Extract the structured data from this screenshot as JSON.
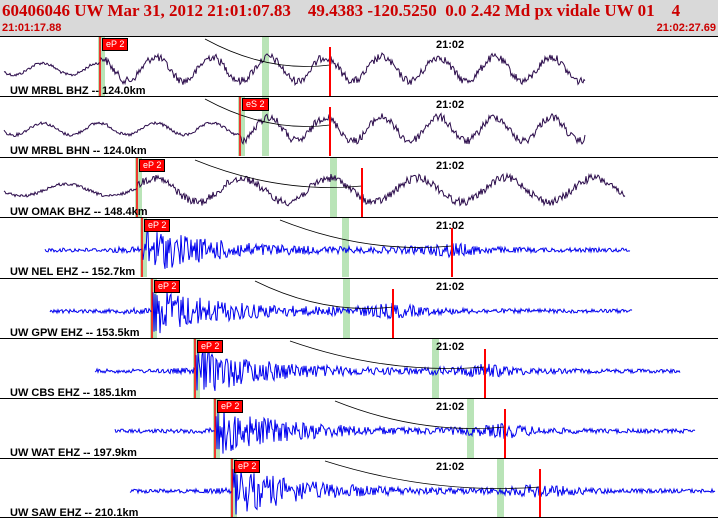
{
  "header": {
    "title": "60406046 UW Mar 31, 2012 21:01:07.83    49.4383 -120.5250  0.0 2.42 Md px vidale UW 01    4",
    "time_start": "21:01:17.88",
    "time_end": "21:02:27.69"
  },
  "colors": {
    "header_bg": "#d9d9d9",
    "header_text": "#cc0000",
    "broadband_trace": "#2a0a4a",
    "shortperiod_trace": "#0000ee",
    "pick_marker": "#ff0000",
    "window_bar": "#b9e4b7"
  },
  "traces": [
    {
      "label": "UW MRBL BHZ -- 124.0km",
      "clock": "21:02",
      "pick": "eP 2",
      "kind": "broadband"
    },
    {
      "label": "UW MRBL BHN -- 124.0km",
      "clock": "21:02",
      "pick": "eS 2",
      "kind": "broadband"
    },
    {
      "label": "UW OMAK BHZ -- 148.4km",
      "clock": "21:02",
      "pick": "eP 2",
      "kind": "broadband"
    },
    {
      "label": "UW NEL EHZ -- 152.7km",
      "clock": "21:02",
      "pick": "eP 2",
      "kind": "shortperiod"
    },
    {
      "label": "UW GPW EHZ -- 153.5km",
      "clock": "21:02",
      "pick": "eP 2",
      "kind": "shortperiod"
    },
    {
      "label": "UW CBS EHZ -- 185.1km",
      "clock": "21:02",
      "pick": "eP 2",
      "kind": "shortperiod"
    },
    {
      "label": "UW WAT EHZ -- 197.9km",
      "clock": "21:02",
      "pick": "eP 2",
      "kind": "shortperiod"
    },
    {
      "label": "UW SAW EHZ -- 210.1km",
      "clock": "21:02",
      "pick": "eP 2",
      "kind": "shortperiod"
    }
  ]
}
